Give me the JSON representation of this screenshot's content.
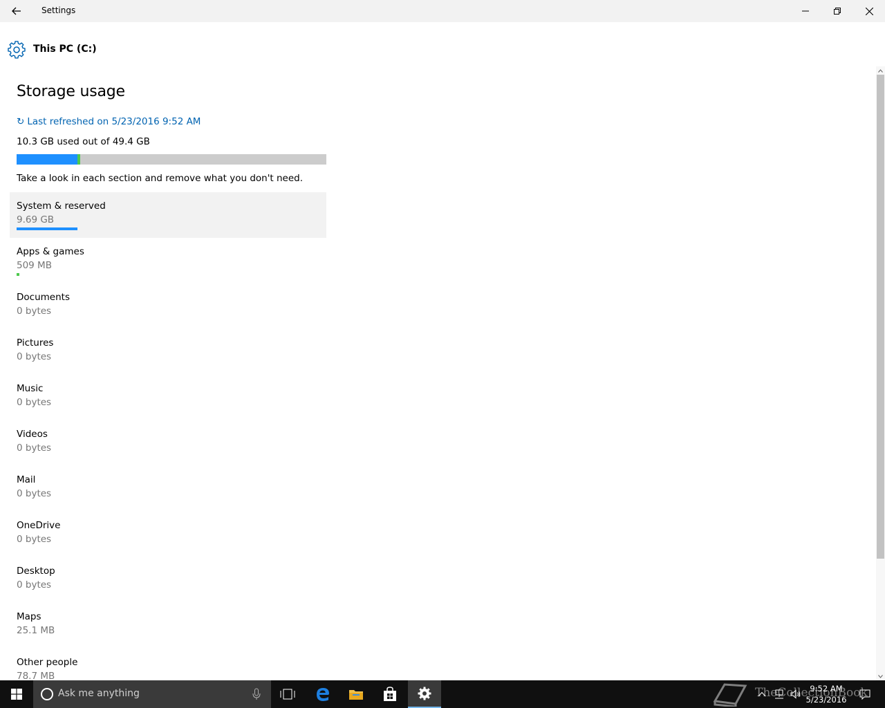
{
  "window": {
    "title": "Settings"
  },
  "header": {
    "title": "This PC (C:)",
    "icon": "gear-icon"
  },
  "main": {
    "heading": "Storage usage",
    "refresh_glyph": "↻",
    "refresh_label": "Last refreshed on 5/23/2016 9:52 AM",
    "summary": "10.3 GB used out of 49.4 GB",
    "usage_bar": {
      "system_fraction": 0.196,
      "apps_fraction": 0.01
    },
    "hint": "Take a look in each section and remove what you don't need.",
    "categories": [
      {
        "name": "System & reserved",
        "size": "9.69 GB",
        "bar_fraction": 0.196,
        "bar_color": "#1e90ff"
      },
      {
        "name": "Apps & games",
        "size": "509 MB",
        "bar_fraction": 0.01,
        "bar_color": "#4ec94e"
      },
      {
        "name": "Documents",
        "size": "0 bytes"
      },
      {
        "name": "Pictures",
        "size": "0 bytes"
      },
      {
        "name": "Music",
        "size": "0 bytes"
      },
      {
        "name": "Videos",
        "size": "0 bytes"
      },
      {
        "name": "Mail",
        "size": "0 bytes"
      },
      {
        "name": "OneDrive",
        "size": "0 bytes"
      },
      {
        "name": "Desktop",
        "size": "0 bytes"
      },
      {
        "name": "Maps",
        "size": "25.1 MB"
      },
      {
        "name": "Other people",
        "size": "78.7 MB"
      }
    ]
  },
  "taskbar": {
    "search_placeholder": "Ask me anything",
    "clock_time": "9:52 AM",
    "clock_date": "5/23/2016",
    "watermark": "TheCollectionBook",
    "accent": "#76b9ed"
  },
  "colors": {
    "link": "#0063b1",
    "system_bar": "#1e90ff",
    "apps_bar": "#4ec94e",
    "bar_track": "#cccccc",
    "secondary_text": "#767676"
  }
}
